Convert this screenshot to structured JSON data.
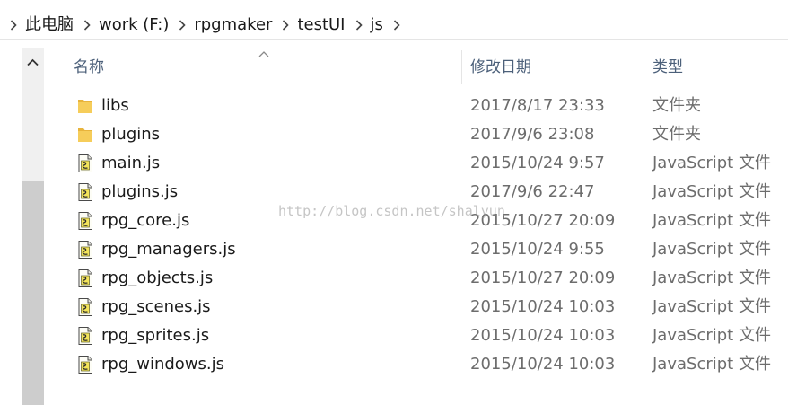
{
  "breadcrumbs": [
    "此电脑",
    "work (F:)",
    "rpgmaker",
    "testUI",
    "js"
  ],
  "columns": {
    "name": "名称",
    "date": "修改日期",
    "type": "类型"
  },
  "files": [
    {
      "name": "libs",
      "date": "2017/8/17 23:33",
      "type": "文件夹",
      "icon": "folder-icon"
    },
    {
      "name": "plugins",
      "date": "2017/9/6 23:08",
      "type": "文件夹",
      "icon": "folder-icon"
    },
    {
      "name": "main.js",
      "date": "2015/10/24 9:57",
      "type": "JavaScript 文件",
      "icon": "js-file-icon"
    },
    {
      "name": "plugins.js",
      "date": "2017/9/6 22:47",
      "type": "JavaScript 文件",
      "icon": "js-file-icon"
    },
    {
      "name": "rpg_core.js",
      "date": "2015/10/27 20:09",
      "type": "JavaScript 文件",
      "icon": "js-file-icon"
    },
    {
      "name": "rpg_managers.js",
      "date": "2015/10/24 9:55",
      "type": "JavaScript 文件",
      "icon": "js-file-icon"
    },
    {
      "name": "rpg_objects.js",
      "date": "2015/10/27 20:09",
      "type": "JavaScript 文件",
      "icon": "js-file-icon"
    },
    {
      "name": "rpg_scenes.js",
      "date": "2015/10/24 10:03",
      "type": "JavaScript 文件",
      "icon": "js-file-icon"
    },
    {
      "name": "rpg_sprites.js",
      "date": "2015/10/24 10:03",
      "type": "JavaScript 文件",
      "icon": "js-file-icon"
    },
    {
      "name": "rpg_windows.js",
      "date": "2015/10/24 10:03",
      "type": "JavaScript 文件",
      "icon": "js-file-icon"
    }
  ],
  "watermark": "http://blog.csdn.net/shalyun",
  "colors": {
    "header_text": "#4c607a",
    "folder": "#f2c553",
    "row_text": "#1a1a1a",
    "meta_text": "#6d6d6d"
  }
}
